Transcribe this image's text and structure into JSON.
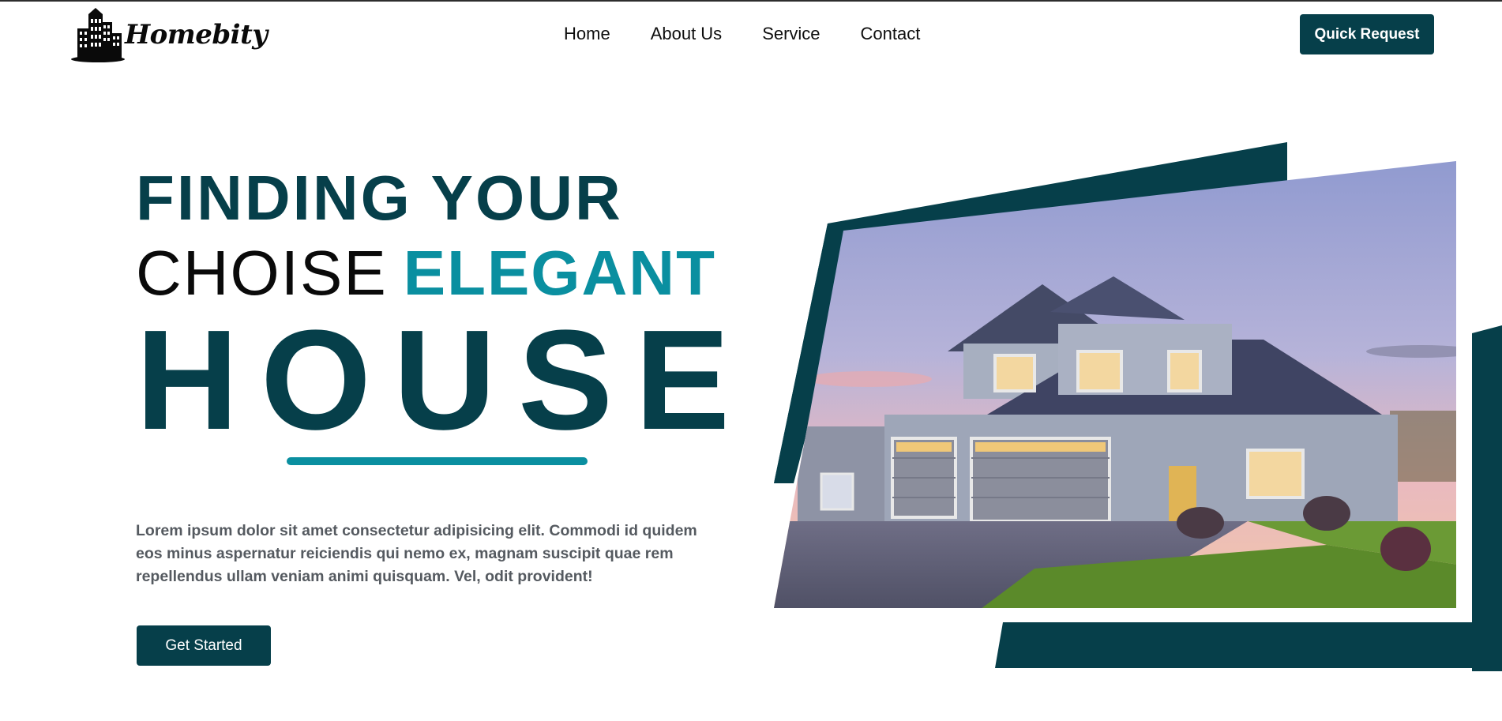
{
  "brand": {
    "name": "Homebity"
  },
  "nav": {
    "items": [
      {
        "label": "Home"
      },
      {
        "label": "About Us"
      },
      {
        "label": "Service"
      },
      {
        "label": "Contact"
      }
    ]
  },
  "header": {
    "cta_label": "Quick Request"
  },
  "hero": {
    "line1": "FINDING YOUR",
    "line2_plain": "CHOISE",
    "line2_accent": "ELEGANT",
    "line3": "HOUSE",
    "description": "Lorem ipsum dolor sit amet consectetur adipisicing elit. Commodi id quidem eos minus aspernatur reiciendis qui nemo ex, magnam suscipit quae rem repellendus ullam veniam animi quisquam. Vel, odit provident!",
    "cta_label": "Get Started"
  },
  "colors": {
    "primary": "#063f4a",
    "accent": "#0a8fa0",
    "text_muted": "#555a60"
  },
  "icons": {
    "logo": "city-buildings-icon",
    "hero_image": "house-photo"
  }
}
